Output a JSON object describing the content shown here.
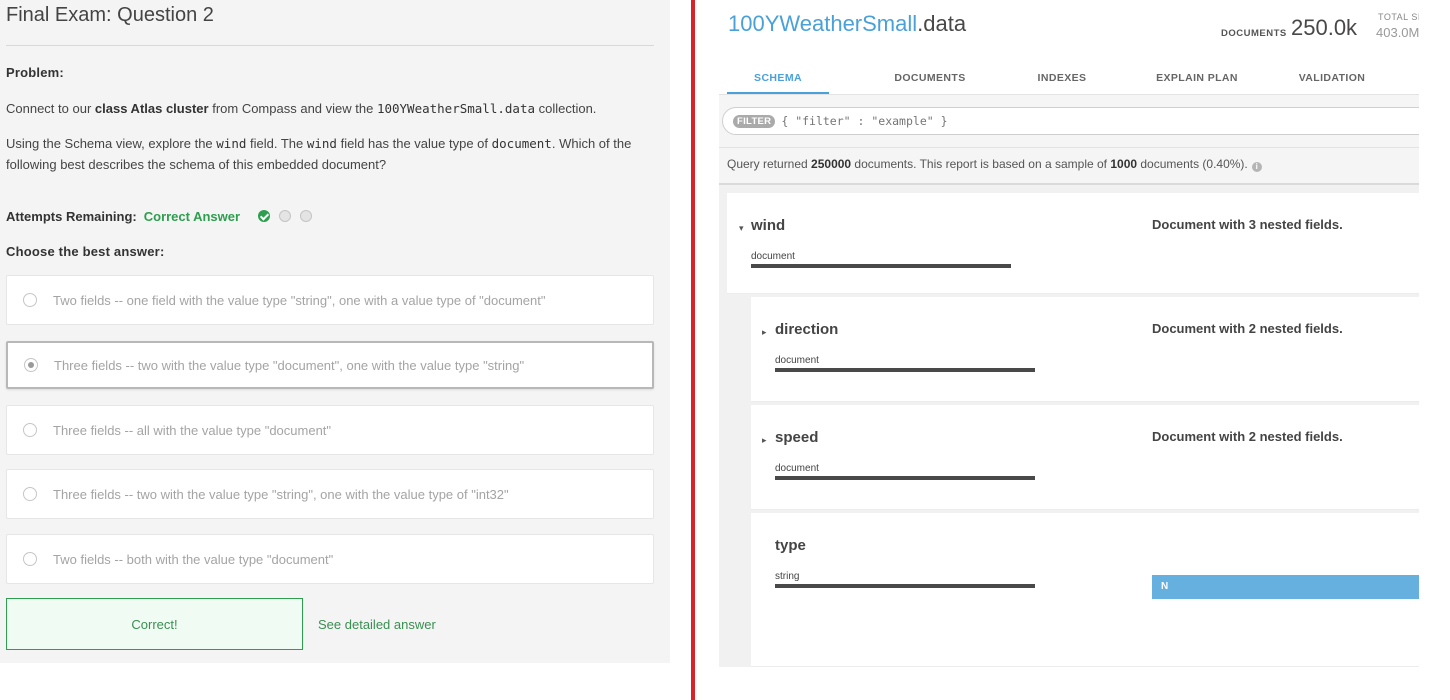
{
  "exam": {
    "title": "Final Exam: Question 2",
    "problem_label": "Problem:",
    "p1_a": "Connect to our ",
    "p1_b": "class Atlas cluster",
    "p1_c": " from Compass and view the ",
    "p1_d": "100YWeatherSmall.data",
    "p1_e": " collection.",
    "p2_a": "Using the Schema view, explore the ",
    "p2_b": "wind",
    "p2_c": " field. The ",
    "p2_d": "wind",
    "p2_e": " field has the value type of ",
    "p2_f": "document",
    "p2_g": ". Which of the following best describes the schema of this embedded document?",
    "attempts_label": "Attempts Remaining:",
    "attempts_status": "Correct Answer",
    "choose_label": "Choose the best answer:",
    "options": [
      "Two fields -- one field with the value type \"string\", one with a value type of \"document\"",
      "Three fields -- two with the value type \"document\", one with the value type \"string\"",
      "Three fields -- all with the value type \"document\"",
      "Three fields -- two with the value type \"string\", one with the value type of \"int32\"",
      "Two fields -- both with the value type \"document\""
    ],
    "correct_label": "Correct!",
    "detail_link": "See detailed answer"
  },
  "compass": {
    "db_name": "100YWeatherSmall",
    "coll_name": ".data",
    "documents_label": "DOCUMENTS",
    "documents_count": "250.0k",
    "total_label": "TOTAL SI",
    "total_value": "403.0M",
    "tabs": [
      "SCHEMA",
      "DOCUMENTS",
      "INDEXES",
      "EXPLAIN PLAN",
      "VALIDATION"
    ],
    "filter_pill": "FILTER",
    "filter_placeholder": "{ \"filter\" : \"example\" }",
    "query": {
      "a": "Query returned ",
      "b": "250000",
      "c": " documents. This report is based on a sample of ",
      "d": "1000",
      "e": " documents (0.40%).",
      "info_icon": "i"
    },
    "fields": [
      {
        "name": "wind",
        "type": "document",
        "desc": "Document with 3 nested fields.",
        "caret": "▾"
      },
      {
        "name": "direction",
        "type": "document",
        "desc": "Document with 2 nested fields.",
        "caret": "▸"
      },
      {
        "name": "speed",
        "type": "document",
        "desc": "Document with 2 nested fields.",
        "caret": "▸"
      },
      {
        "name": "type",
        "type": "string",
        "desc": "",
        "value_bar": "N"
      }
    ]
  }
}
